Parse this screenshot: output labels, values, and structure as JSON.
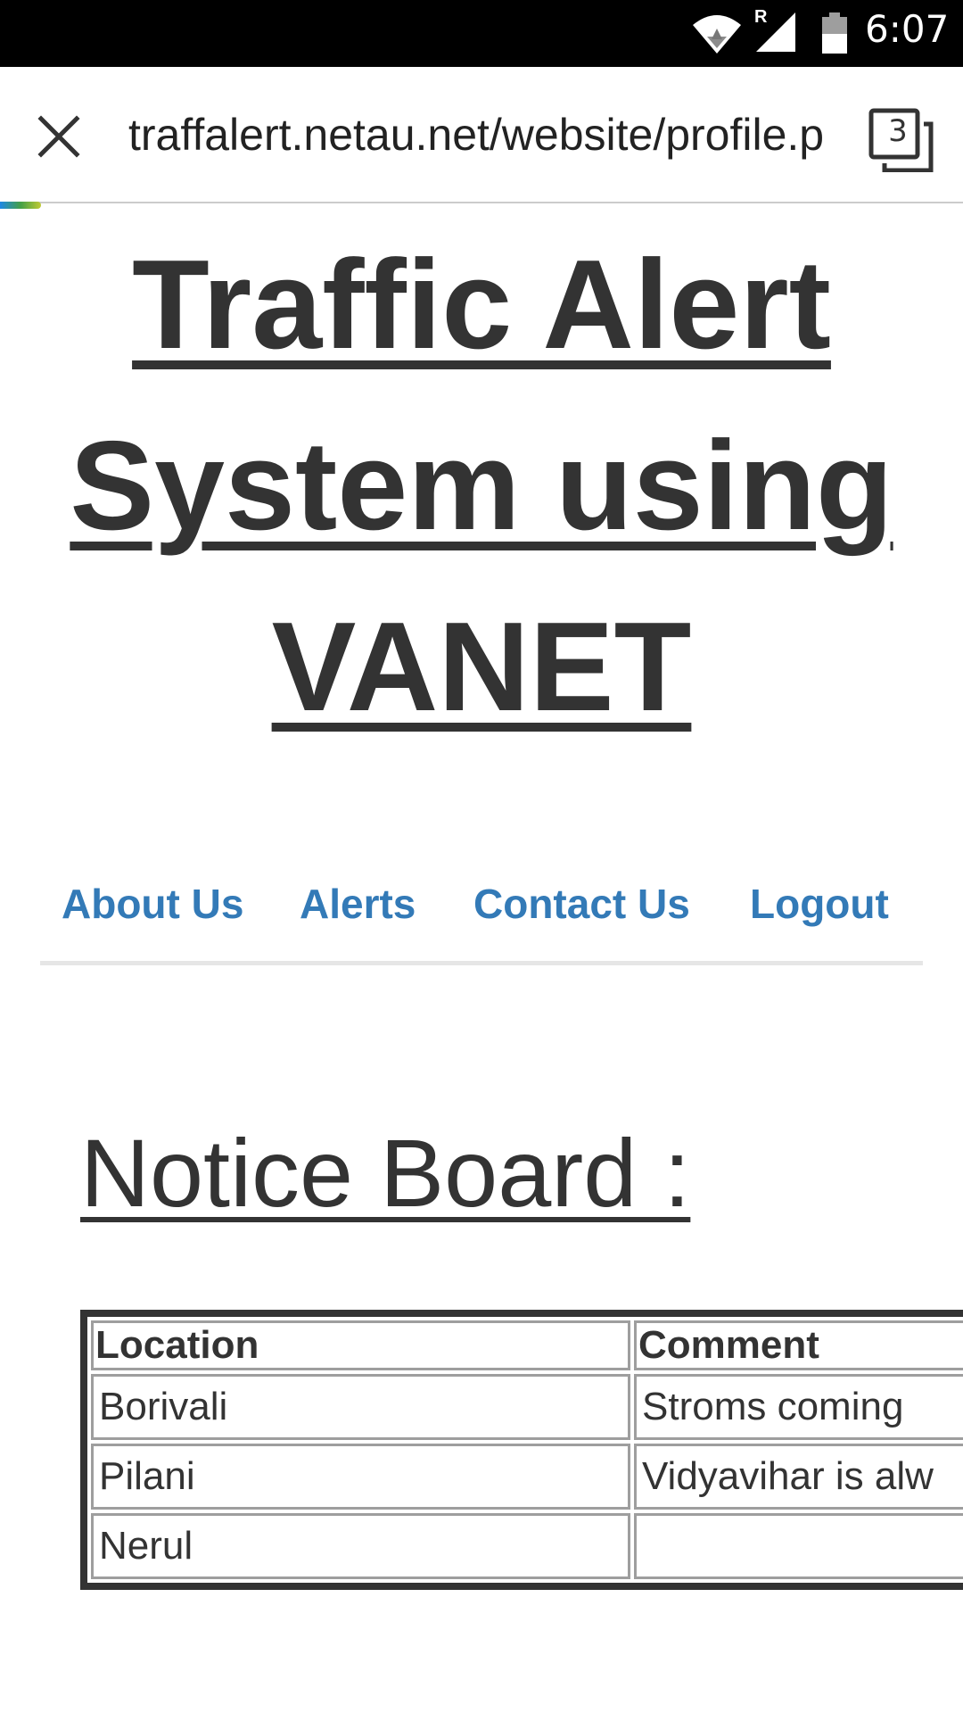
{
  "status_bar": {
    "time": "6:07",
    "roaming_indicator": "R",
    "icons": [
      "wifi-icon",
      "signal-icon",
      "battery-icon"
    ]
  },
  "toolbar": {
    "url": "traffalert.netau.net/website/profile.p",
    "tab_count": "3",
    "icons": [
      "close-icon",
      "tabs-icon"
    ]
  },
  "page": {
    "title": "Traffic Alert System using VANET",
    "nav": [
      {
        "label": "About Us"
      },
      {
        "label": "Alerts"
      },
      {
        "label": "Contact Us"
      },
      {
        "label": "Logout"
      }
    ],
    "notice_heading": "Notice Board :",
    "table": {
      "headers": [
        "Location",
        "Comment"
      ],
      "rows": [
        [
          "Borivali",
          "Stroms coming"
        ],
        [
          "Pilani",
          "Vidyavihar is alw"
        ],
        [
          "Nerul",
          ""
        ]
      ]
    }
  },
  "colors": {
    "link": "#337ab7",
    "text": "#333333",
    "status_bar_bg": "#000000"
  }
}
